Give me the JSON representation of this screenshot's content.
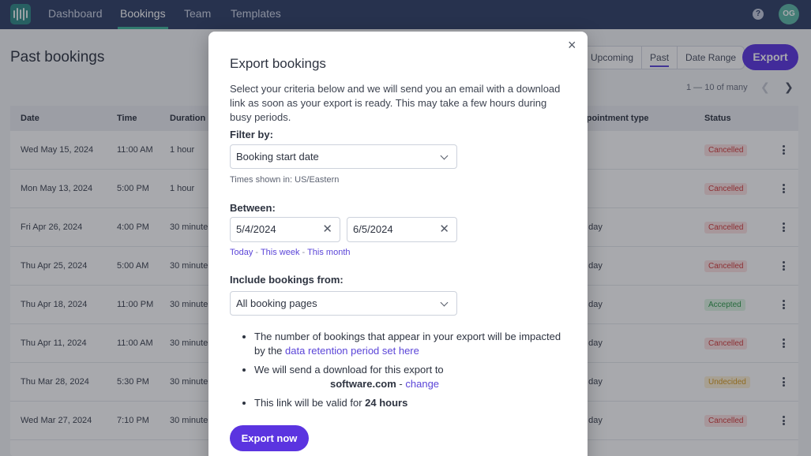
{
  "nav": {
    "items": [
      "Dashboard",
      "Bookings",
      "Team",
      "Templates"
    ],
    "active": "Bookings",
    "help_icon": "?",
    "avatar_initials": "OG"
  },
  "page": {
    "title": "Past bookings",
    "filters": [
      "Upcoming",
      "Past",
      "Date Range"
    ],
    "active_filter": "Past",
    "export_label": "Export",
    "pagination": "1 — 10 of many"
  },
  "table": {
    "columns": [
      "Date",
      "Time",
      "Duration",
      "ppointment type",
      "Status"
    ],
    "rows": [
      {
        "date": "Wed May 15, 2024",
        "time": "11:00 AM",
        "duration": "1 hour",
        "type": "",
        "status": "Cancelled"
      },
      {
        "date": "Mon May 13, 2024",
        "time": "5:00 PM",
        "duration": "1 hour",
        "type": "",
        "status": "Cancelled"
      },
      {
        "date": "Fri Apr 26, 2024",
        "time": "4:00 PM",
        "duration": "30 minute",
        "type": "e day",
        "status": "Cancelled"
      },
      {
        "date": "Thu Apr 25, 2024",
        "time": "5:00 AM",
        "duration": "30 minute",
        "type": "e day",
        "status": "Cancelled"
      },
      {
        "date": "Thu Apr 18, 2024",
        "time": "11:00 PM",
        "duration": "30 minute",
        "type": "e day",
        "status": "Accepted"
      },
      {
        "date": "Thu Apr 11, 2024",
        "time": "11:00 AM",
        "duration": "30 minute",
        "type": "e day",
        "status": "Cancelled"
      },
      {
        "date": "Thu Mar 28, 2024",
        "time": "5:30 PM",
        "duration": "30 minute",
        "type": "e day",
        "status": "Undecided"
      },
      {
        "date": "Wed Mar 27, 2024",
        "time": "7:10 PM",
        "duration": "30 minute",
        "type": "e day",
        "status": "Cancelled"
      }
    ]
  },
  "modal": {
    "close_icon": "×",
    "title": "Export bookings",
    "description": "Select your criteria below and we will send you an email with a download link as soon as your export is ready. This may take a few hours during busy periods.",
    "filter_label": "Filter by:",
    "filter_value": "Booking start date",
    "timezone_hint": "Times shown in: US/Eastern",
    "between_label": "Between:",
    "start_date": "5/4/2024",
    "end_date": "6/5/2024",
    "quick_today": "Today",
    "quick_week": "This week",
    "quick_month": "This month",
    "quick_sep": "-",
    "include_label": "Include bookings from:",
    "include_value": "All booking pages",
    "note1_text": "The number of bookings that appear in your export will be impacted by the ",
    "note1_link": "data retention period set here",
    "note2_text": "We will send a download for this export to",
    "note2_domain": "software.com",
    "note2_sep": " - ",
    "note2_link": "change",
    "note3_text": "This link will be valid for ",
    "note3_bold": "24 hours",
    "export_now_label": "Export now"
  }
}
